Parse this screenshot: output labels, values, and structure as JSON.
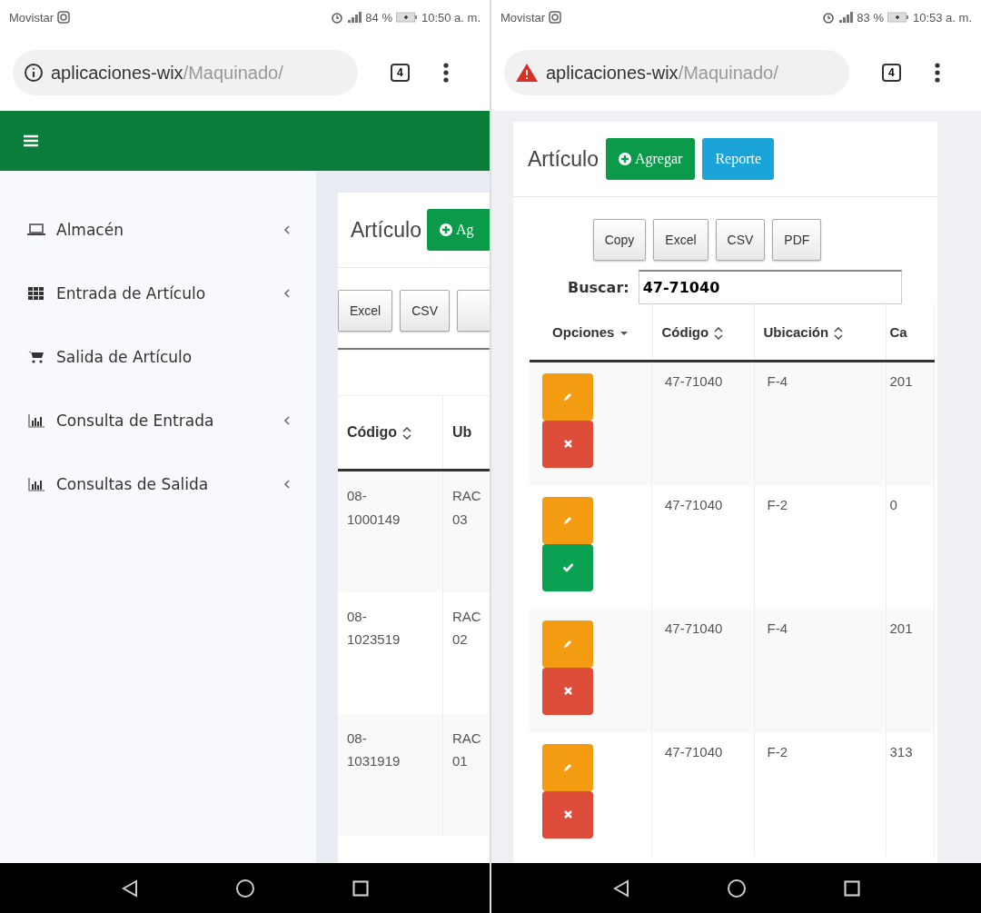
{
  "left_screen": {
    "status_bar": {
      "carrier": "Movistar",
      "battery": "84 %",
      "time": "10:50 a. m."
    },
    "address_bar": {
      "insecure": false,
      "host": "aplicaciones-wix",
      "path": "/Maquinado/",
      "tab_count": "4"
    },
    "sidebar": {
      "items": [
        {
          "label": "Almacén",
          "has_submenu": true
        },
        {
          "label": "Entrada de Artículo",
          "has_submenu": true
        },
        {
          "label": "Salida de Artículo",
          "has_submenu": false
        },
        {
          "label": "Consulta de Entrada",
          "has_submenu": true
        },
        {
          "label": "Consultas de Salida",
          "has_submenu": true
        }
      ]
    },
    "panel": {
      "title": "Artículo",
      "add_button": "Ag",
      "export_buttons": [
        "Excel",
        "CSV"
      ],
      "columns": [
        "Código",
        "Ub"
      ],
      "rows": [
        {
          "cells": [
            [
              "08-",
              "1000149"
            ],
            [
              "RAC",
              "03"
            ]
          ]
        },
        {
          "cells": [
            [
              "08-",
              "1023519"
            ],
            [
              "RAC",
              "02"
            ]
          ]
        },
        {
          "cells": [
            [
              "08-",
              "1031919"
            ],
            [
              "RAC",
              "01"
            ]
          ]
        }
      ]
    }
  },
  "right_screen": {
    "status_bar": {
      "carrier": "Movistar",
      "battery": "83 %",
      "time": "10:53 a. m."
    },
    "address_bar": {
      "insecure": true,
      "host": "aplicaciones-wix",
      "path": "/Maquinado/",
      "tab_count": "4"
    },
    "panel": {
      "title": "Artículo",
      "buttons": [
        {
          "label": "Agregar",
          "kind": "add"
        },
        {
          "label": "Reporte",
          "kind": "report"
        }
      ],
      "export_buttons": [
        "Copy",
        "Excel",
        "CSV",
        "PDF"
      ],
      "search": {
        "label": "Buscar:",
        "value": "47-71040"
      },
      "columns": [
        {
          "label": "Opciones",
          "kind": "dropdown"
        },
        {
          "label": "Código",
          "kind": "sortable"
        },
        {
          "label": "Ubicación",
          "kind": "sortable"
        },
        {
          "label": "Ca",
          "kind": "plain"
        }
      ],
      "rows": [
        {
          "cells": [
            {
              "actions": [
                {
                  "kind": "edit"
                },
                {
                  "kind": "delete"
                }
              ]
            },
            "47-71040",
            "F-4",
            "201"
          ]
        },
        {
          "cells": [
            {
              "actions": [
                {
                  "kind": "edit"
                },
                {
                  "kind": "approve"
                }
              ]
            },
            "47-71040",
            "F-2",
            "0"
          ]
        },
        {
          "cells": [
            {
              "actions": [
                {
                  "kind": "edit"
                },
                {
                  "kind": "delete"
                }
              ]
            },
            "47-71040",
            "F-4",
            "201"
          ]
        },
        {
          "cells": [
            {
              "actions": [
                {
                  "kind": "edit"
                },
                {
                  "kind": "delete"
                }
              ]
            },
            "47-71040",
            "F-2",
            "313"
          ]
        }
      ]
    }
  }
}
